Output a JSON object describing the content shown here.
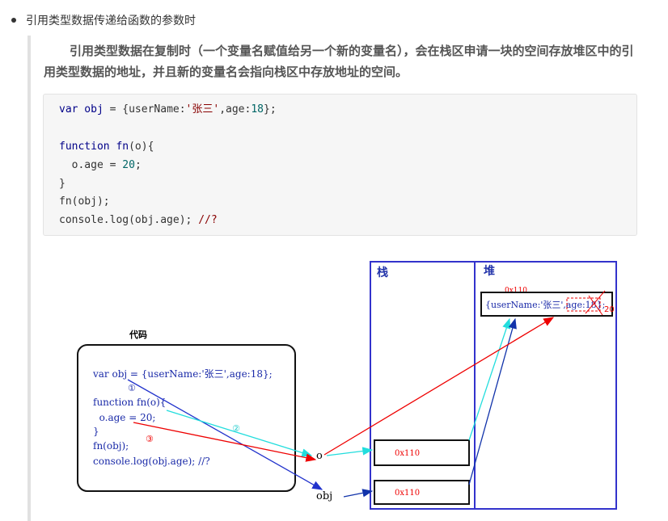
{
  "bullet": {
    "text": "引用类型数据传递给函数的参数时"
  },
  "paragraph": {
    "text": "引用类型数据在复制时（一个变量名赋值给另一个新的变量名），会在栈区申请一块的空间存放堆区中的引用类型数据的地址，并且新的变量名会指向栈区中存放地址的空间。"
  },
  "code": {
    "line1": {
      "kw": "var",
      "name": " obj",
      "rest1": " = {userName:",
      "str": "'张三'",
      "rest2": ",age:",
      "num": "18",
      "rest3": "};"
    },
    "line3": {
      "kw": "function",
      "name": " fn",
      "rest": "(o){"
    },
    "line4": {
      "text": "  o.age = ",
      "num": "20",
      "rest": ";"
    },
    "line5": {
      "text": "}"
    },
    "line6": {
      "text": "fn(obj);"
    },
    "line7": {
      "text": "console.log(obj.age); ",
      "com": "//?"
    }
  },
  "diagram": {
    "code_label": "代码",
    "code_lines": [
      "var obj = {userName:'张三',age:18};",
      "function fn(o){",
      "  o.age = 20;",
      "}",
      "fn(obj);",
      "console.log(obj.age); //?"
    ],
    "markers": [
      "①",
      "②",
      "③"
    ],
    "stack_label": "栈",
    "heap_label": "堆",
    "heap_address": "0x110",
    "heap_object_text": "{userName:'张三',age:18};",
    "heap_new_value": "20",
    "stack_cell_o": "0x110",
    "stack_cell_obj": "0x110",
    "var_o": "o",
    "var_obj": "obj",
    "colors": {
      "blue": "#2233cc",
      "cyan": "#22dddd",
      "red": "#ee0000",
      "navy": "#1133aa"
    }
  }
}
